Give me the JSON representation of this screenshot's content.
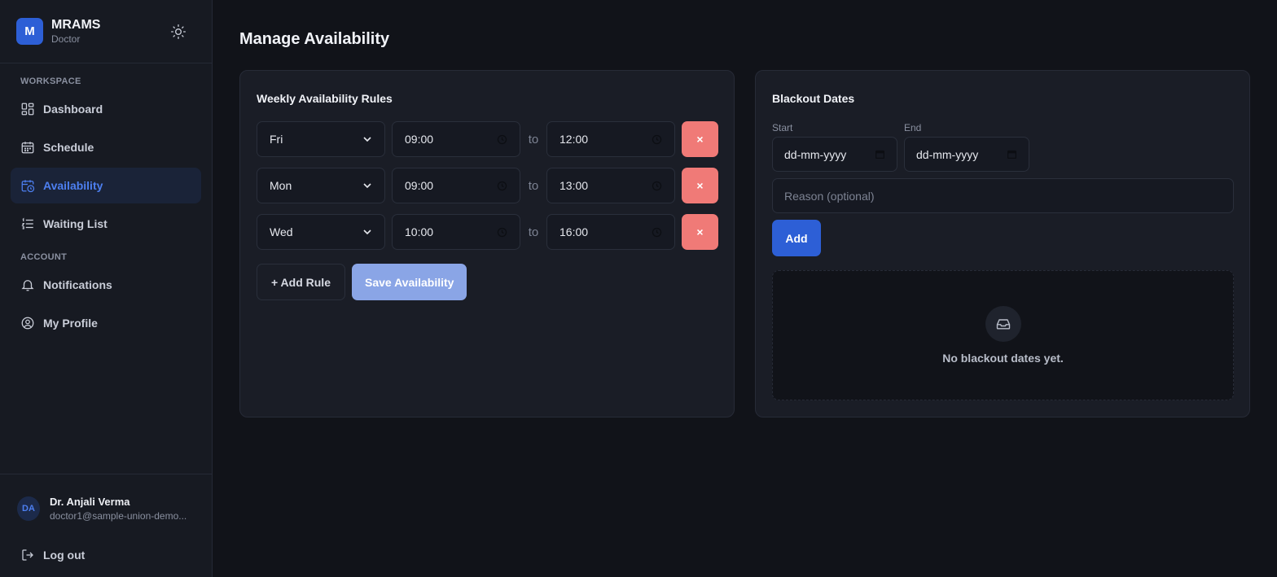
{
  "brand": {
    "logo_letter": "M",
    "name": "MRAMS",
    "role": "Doctor"
  },
  "sidebar": {
    "workspace_label": "WORKSPACE",
    "workspace_items": [
      {
        "label": "Dashboard",
        "icon": "dashboard-icon"
      },
      {
        "label": "Schedule",
        "icon": "calendar-icon"
      },
      {
        "label": "Availability",
        "icon": "calendar-clock-icon",
        "active": true
      },
      {
        "label": "Waiting List",
        "icon": "list-icon"
      }
    ],
    "account_label": "ACCOUNT",
    "account_items": [
      {
        "label": "Notifications",
        "icon": "bell-icon"
      },
      {
        "label": "My Profile",
        "icon": "user-circle-icon"
      }
    ],
    "user": {
      "initials": "DA",
      "name": "Dr. Anjali Verma",
      "email": "doctor1@sample-union-demo..."
    },
    "logout_label": "Log out"
  },
  "page": {
    "title": "Manage Availability"
  },
  "rules": {
    "title": "Weekly Availability Rules",
    "to_label": "to",
    "delete_label": "×",
    "rows": [
      {
        "day": "Fri",
        "start": "09:00",
        "end": "12:00"
      },
      {
        "day": "Mon",
        "start": "09:00",
        "end": "13:00"
      },
      {
        "day": "Wed",
        "start": "10:00",
        "end": "16:00"
      }
    ],
    "add_rule_label": "+ Add Rule",
    "save_label": "Save Availability"
  },
  "blackout": {
    "title": "Blackout Dates",
    "start_label": "Start",
    "end_label": "End",
    "start_value": "dd-mm-yyyy",
    "end_value": "dd-mm-yyyy",
    "reason_placeholder": "Reason (optional)",
    "add_label": "Add",
    "empty_text": "No blackout dates yet."
  },
  "colors": {
    "accent": "#2d5fd6",
    "danger": "#f07a77",
    "save_disabled": "#8aa5e6",
    "background": "#111319",
    "card": "#1a1d26"
  }
}
